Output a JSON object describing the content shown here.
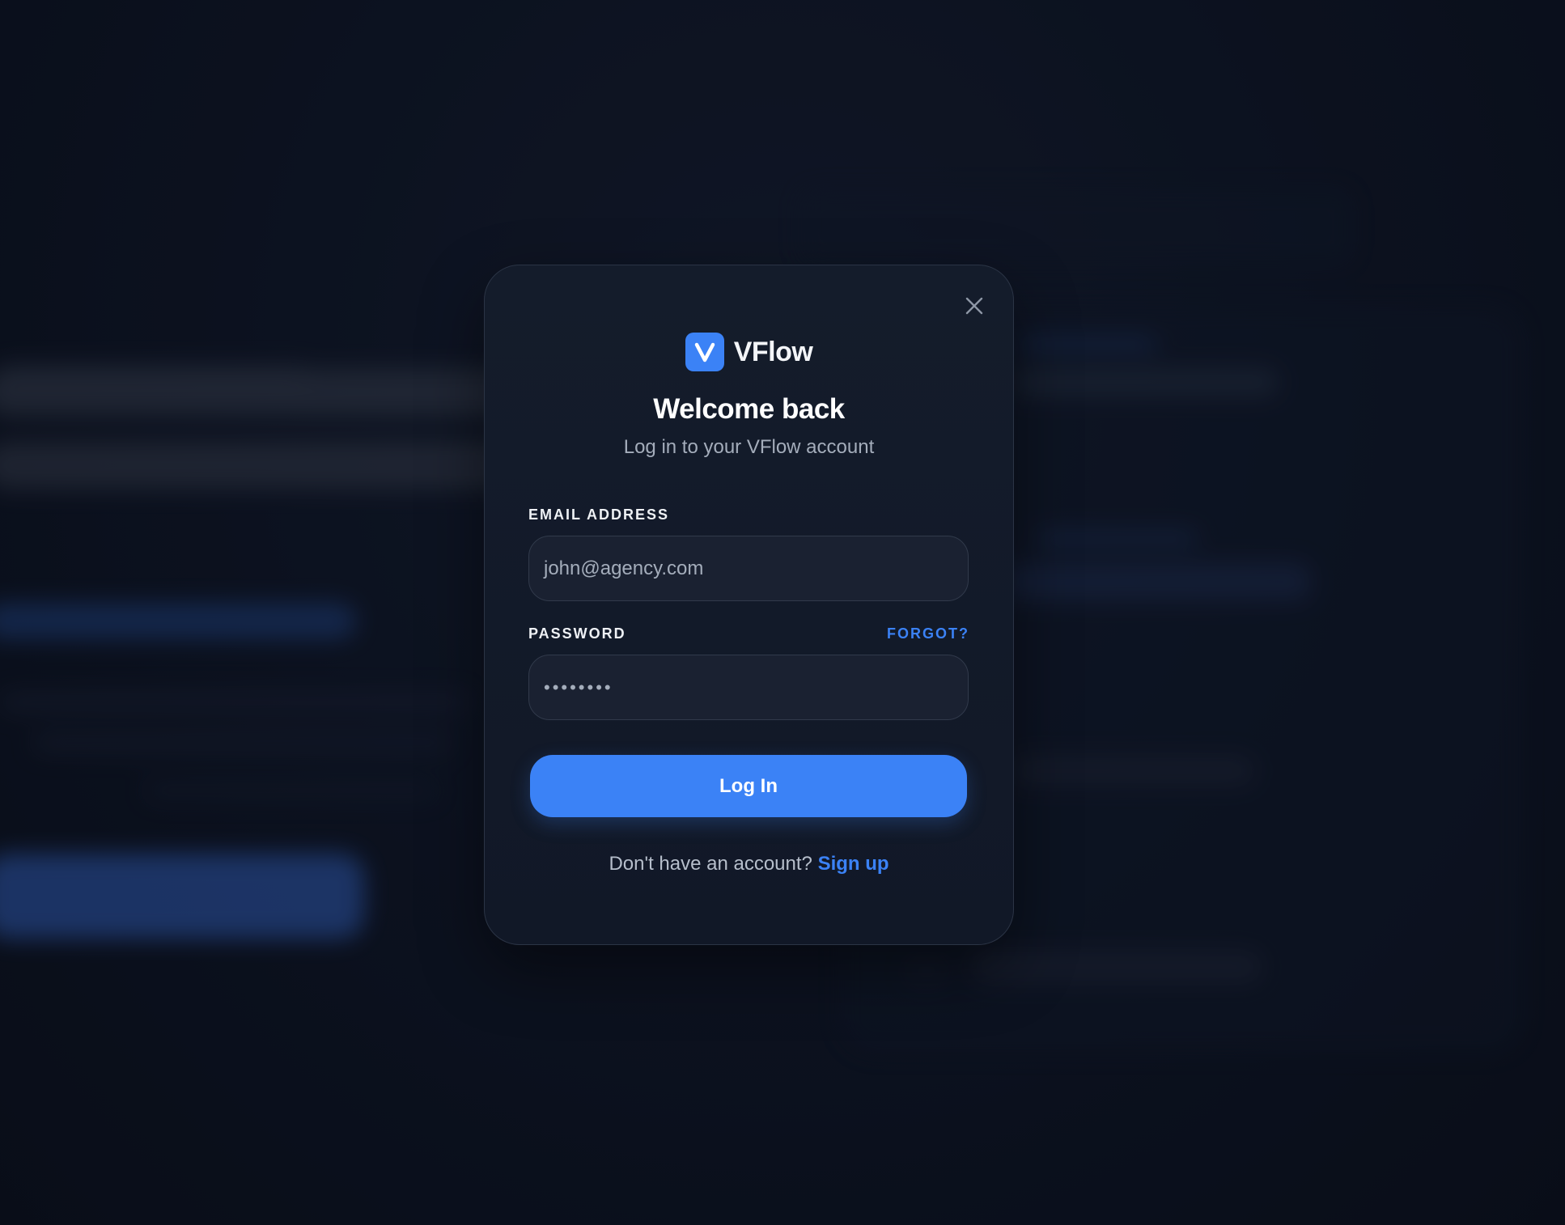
{
  "brand": {
    "name": "VFlow",
    "logo_icon": "v-logo-icon",
    "accent_color": "#3b82f6"
  },
  "modal": {
    "title": "Welcome back",
    "subtitle": "Log in to your VFlow account",
    "close_icon": "close-icon"
  },
  "form": {
    "email": {
      "label": "EMAIL ADDRESS",
      "value": "john@agency.com"
    },
    "password": {
      "label": "PASSWORD",
      "value": "••••••••",
      "forgot_label": "FORGOT?"
    },
    "submit_label": "Log In"
  },
  "footer": {
    "prompt": "Don't have an account?",
    "signup_label": "Sign up"
  }
}
